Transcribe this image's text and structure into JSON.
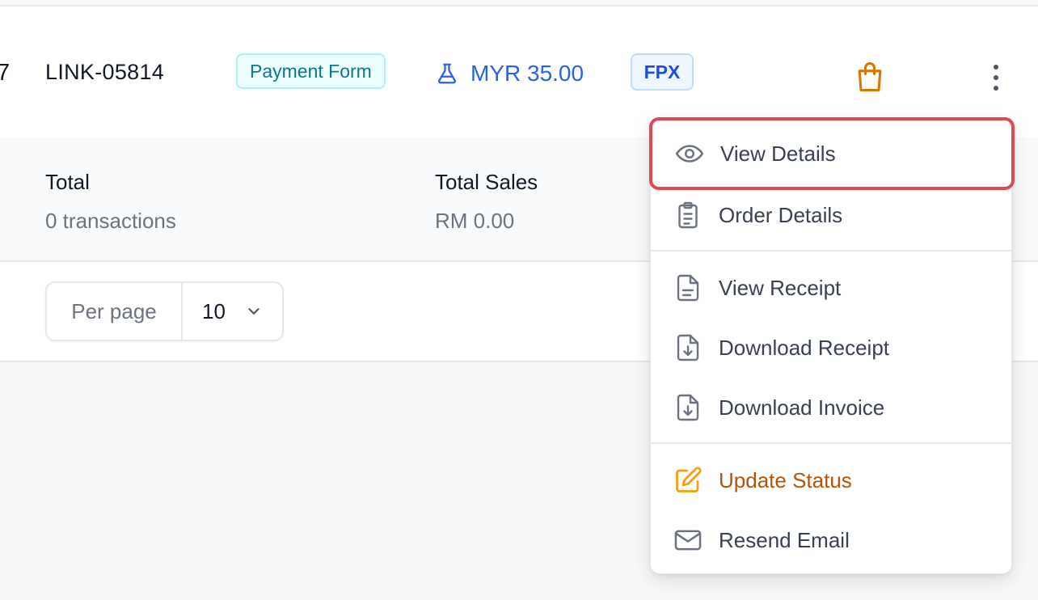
{
  "row": {
    "cut_text": "7",
    "link_id": "LINK-05814",
    "type_badge": "Payment Form",
    "amount": "MYR 35.00",
    "amount_icon": "flask-icon",
    "method_badge": "FPX",
    "channel_icon": "shopping-bag-icon"
  },
  "summary": {
    "total_label": "Total",
    "total_value": "0 transactions",
    "sales_label": "Total Sales",
    "sales_value": "RM 0.00"
  },
  "pagination": {
    "per_page_label": "Per page",
    "per_page_value": "10"
  },
  "menu": {
    "items": [
      {
        "label": "View Details",
        "icon": "eye-icon"
      },
      {
        "label": "Order Details",
        "icon": "clipboard-icon"
      },
      {
        "label": "View Receipt",
        "icon": "file-icon"
      },
      {
        "label": "Download Receipt",
        "icon": "file-download-icon"
      },
      {
        "label": "Download Invoice",
        "icon": "file-download-icon"
      },
      {
        "label": "Update Status",
        "icon": "edit-icon"
      },
      {
        "label": "Resend Email",
        "icon": "mail-icon"
      }
    ]
  },
  "colors": {
    "accent_blue": "#2563eb",
    "warning": "#b45309",
    "highlight_border": "#dc4b55",
    "bag_orange": "#d97706"
  }
}
